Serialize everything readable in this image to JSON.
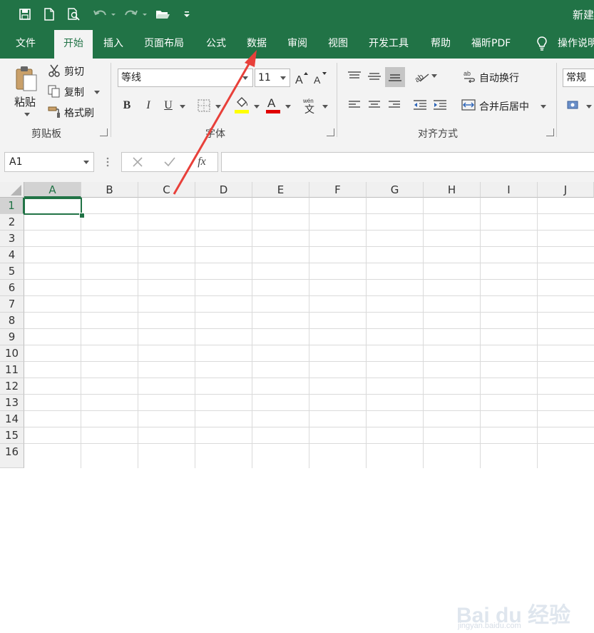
{
  "window": {
    "title": "新建"
  },
  "ribbon_tabs": [
    "文件",
    "开始",
    "插入",
    "页面布局",
    "公式",
    "数据",
    "审阅",
    "视图",
    "开发工具",
    "帮助",
    "福昕PDF"
  ],
  "active_tab": "开始",
  "tell_me": "操作说明",
  "clipboard": {
    "paste": "粘贴",
    "cut": "剪切",
    "copy": "复制",
    "format_painter": "格式刷",
    "group_label": "剪贴板"
  },
  "font": {
    "name": "等线",
    "size": "11",
    "group_label": "字体",
    "wen_label": "wén"
  },
  "alignment": {
    "wrap_text": "自动换行",
    "merge_center": "合并后居中",
    "group_label": "对齐方式"
  },
  "number": {
    "format": "常规"
  },
  "formula_bar": {
    "name_box": "A1",
    "fx": "fx",
    "value": ""
  },
  "grid": {
    "columns": [
      "A",
      "B",
      "C",
      "D",
      "E",
      "F",
      "G",
      "H",
      "I",
      "J"
    ],
    "rows": [
      "1",
      "2",
      "3",
      "4",
      "5",
      "6",
      "7",
      "8",
      "9",
      "10",
      "11",
      "12",
      "13",
      "14",
      "15",
      "16"
    ],
    "selected_cell": "A1"
  },
  "colors": {
    "brand": "#217346",
    "arrow": "#e8403a",
    "highlight": "#ffff00",
    "font_color": "#e00000"
  },
  "watermark": {
    "text": "Bai du 经验",
    "url": "jingyan.baidu.com"
  }
}
